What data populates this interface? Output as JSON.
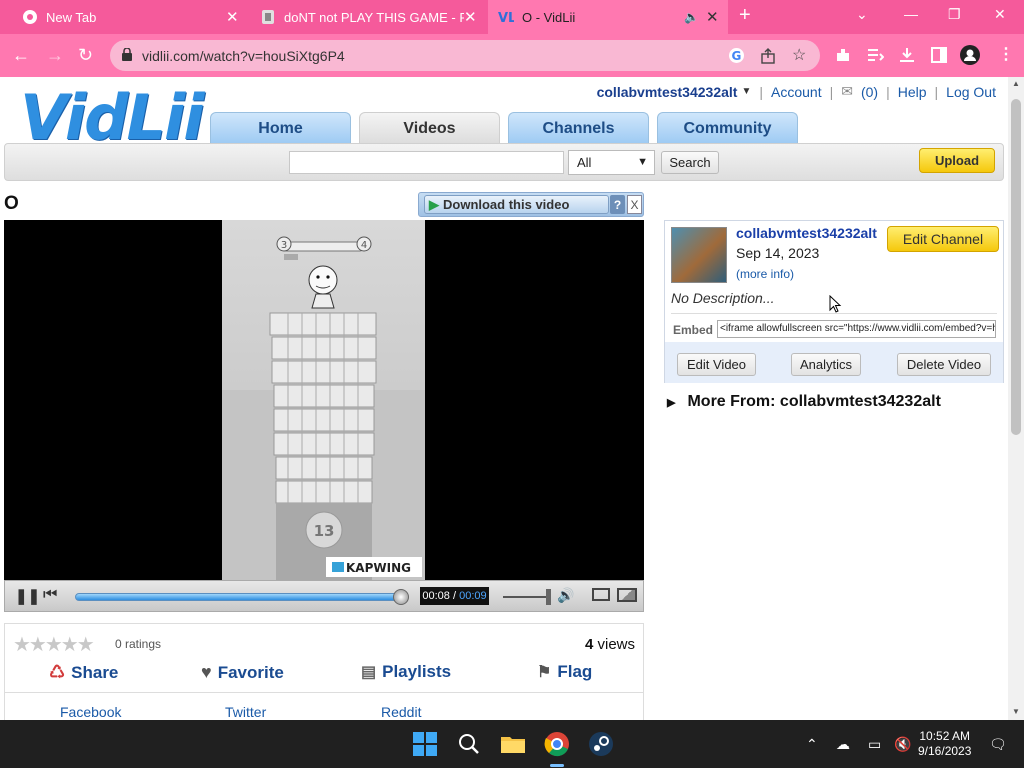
{
  "browser": {
    "tabs": [
      {
        "title": "New Tab",
        "icon": "chrome-icon",
        "active": false
      },
      {
        "title": "doNT not PLAY THIS GAME - Rol",
        "icon": "page-icon",
        "active": false
      },
      {
        "title": "O - VidLii",
        "icon": "vidlii-icon",
        "active": true
      }
    ],
    "new_tab": "+",
    "url": "vidlii.com/watch?v=houSiXtg6P4"
  },
  "header": {
    "logo": "VidLii",
    "username": "collabvmtest34232alt",
    "account": "Account",
    "inbox": "(0)",
    "help": "Help",
    "logout": "Log Out"
  },
  "nav": {
    "tabs": [
      "Home",
      "Videos",
      "Channels",
      "Community"
    ],
    "active": "Videos"
  },
  "search": {
    "value": "",
    "select": "All",
    "button": "Search",
    "upload": "Upload"
  },
  "video": {
    "title": "O",
    "download": "Download this video",
    "help": "?",
    "close": "X",
    "watermark": "KAPWING",
    "counter": "13",
    "level_from": "3",
    "level_to": "4",
    "time_current": "00:08",
    "time_total": "00:09",
    "progress_fraction": 0.97,
    "volume_fraction": 0.9
  },
  "stats": {
    "rating_count": "0 ratings",
    "views_num": "4",
    "views_label": "views"
  },
  "actions": [
    "Share",
    "Favorite",
    "Playlists",
    "Flag"
  ],
  "social": [
    "Facebook",
    "Twitter",
    "Reddit"
  ],
  "channel": {
    "name": "collabvmtest34232alt",
    "date": "Sep 14, 2023",
    "more_info": "(more info)",
    "edit_channel": "Edit Channel",
    "description": "No Description...",
    "embed_label": "Embed",
    "embed_value": "<iframe allowfullscreen src=\"https://www.vidlii.com/embed?v=h",
    "edit_video": "Edit Video",
    "analytics": "Analytics",
    "delete_video": "Delete Video",
    "more_from": "More From: collabvmtest34232alt"
  },
  "taskbar": {
    "time": "10:52 AM",
    "date": "9/16/2023"
  }
}
